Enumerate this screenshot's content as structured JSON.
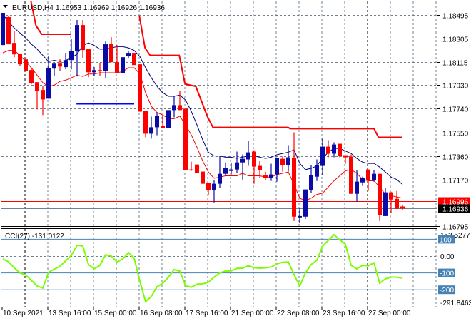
{
  "header": {
    "menu_icon": "triangle-down-icon",
    "symbol": "EURUSD,H4",
    "ohlc": "1.16953 1.16969 1.16926 1.16936"
  },
  "colors": {
    "bull": "#0a0aa8",
    "bear": "#ff0000",
    "ma_fast": "#ff0000",
    "ma_slow": "#000080",
    "stop_line": "#ff0000",
    "level_line": "#0000ff",
    "cci": "#7cfc00",
    "cci_levels": "#4682b4",
    "grid": "#708090",
    "bid_tag": "#ff0000",
    "ask_tag": "#000000"
  },
  "chart_data": [
    {
      "type": "candlestick",
      "title": "EURUSD,H4",
      "ylim": [
        1.16795,
        1.18495
      ],
      "price_ticks": [
        "1.18495",
        "1.18305",
        "1.18115",
        "1.17930",
        "1.17740",
        "1.17550",
        "1.17360",
        "1.17170",
        "1.16795"
      ],
      "price_tags": [
        {
          "label": "1.16996",
          "value": 1.16996,
          "kind": "bid"
        },
        {
          "label": "1.16936",
          "value": 1.16936,
          "kind": "ask"
        }
      ],
      "time_labels": [
        {
          "label": "10 Sep 2021",
          "index": 0
        },
        {
          "label": "13 Sep 16:00",
          "index": 8
        },
        {
          "label": "15 Sep 00:00",
          "index": 16
        },
        {
          "label": "16 Sep 08:00",
          "index": 24
        },
        {
          "label": "17 Sep 16:00",
          "index": 32
        },
        {
          "label": "21 Sep 00:00",
          "index": 40
        },
        {
          "label": "22 Sep 08:00",
          "index": 48
        },
        {
          "label": "23 Sep 16:00",
          "index": 56
        },
        {
          "label": "27 Sep 00:00",
          "index": 64
        }
      ],
      "candles": [
        [
          1.18253,
          1.18512,
          1.18253,
          1.18512
        ],
        [
          1.18478,
          1.18484,
          1.18259,
          1.18259
        ],
        [
          1.1827,
          1.18368,
          1.18155,
          1.18178
        ],
        [
          1.18184,
          1.18184,
          1.18086,
          1.18098
        ],
        [
          1.18138,
          1.18138,
          1.18046,
          1.18046
        ],
        [
          1.18052,
          1.18069,
          1.17937,
          1.17948
        ],
        [
          1.17954,
          1.17954,
          1.17735,
          1.17885
        ],
        [
          1.17891,
          1.17925,
          1.17689,
          1.17815
        ],
        [
          1.17821,
          1.18167,
          1.17821,
          1.18069
        ],
        [
          1.18063,
          1.18109,
          1.18005,
          1.18103
        ],
        [
          1.18103,
          1.18138,
          1.18046,
          1.1808
        ],
        [
          1.18075,
          1.1819,
          1.18057,
          1.18132
        ],
        [
          1.18132,
          1.18299,
          1.18057,
          1.18207
        ],
        [
          1.18207,
          1.18455,
          1.18,
          1.18414
        ],
        [
          1.18414,
          1.18455,
          1.18149,
          1.18213
        ],
        [
          1.18219,
          1.18219,
          1.17994,
          1.18034
        ],
        [
          1.18034,
          1.18075,
          1.18005,
          1.18051
        ],
        [
          1.18051,
          1.18109,
          1.18005,
          1.18046
        ],
        [
          1.18046,
          1.18282,
          1.17988,
          1.18259
        ],
        [
          1.18265,
          1.18316,
          1.18115,
          1.18115
        ],
        [
          1.18115,
          1.18253,
          1.18028,
          1.18028
        ],
        [
          1.18028,
          1.18155,
          1.18028,
          1.18155
        ],
        [
          1.18167,
          1.18207,
          1.18144,
          1.1819
        ],
        [
          1.1819,
          1.1819,
          1.18092,
          1.18092
        ],
        [
          1.18098,
          1.18098,
          1.17717,
          1.17717
        ],
        [
          1.17723,
          1.17723,
          1.1751,
          1.17539
        ],
        [
          1.17539,
          1.17677,
          1.17499,
          1.17591
        ],
        [
          1.17591,
          1.17712,
          1.17527,
          1.17683
        ],
        [
          1.17602,
          1.17689,
          1.17585,
          1.17585
        ],
        [
          1.17585,
          1.17729,
          1.17585,
          1.17729
        ],
        [
          1.17729,
          1.17844,
          1.17671,
          1.17769
        ],
        [
          1.17769,
          1.17884,
          1.17729,
          1.17729
        ],
        [
          1.1774,
          1.1774,
          1.17245,
          1.17245
        ],
        [
          1.17251,
          1.17314,
          1.17239,
          1.17245
        ],
        [
          1.17291,
          1.17291,
          1.17222,
          1.17222
        ],
        [
          1.17234,
          1.17234,
          1.17136,
          1.17136
        ],
        [
          1.17141,
          1.17141,
          1.17044,
          1.17084
        ],
        [
          1.17084,
          1.17164,
          1.16986,
          1.17136
        ],
        [
          1.17136,
          1.1736,
          1.17101,
          1.17216
        ],
        [
          1.17216,
          1.17308,
          1.17199,
          1.17262
        ],
        [
          1.17239,
          1.17303,
          1.17211,
          1.17251
        ],
        [
          1.17251,
          1.17395,
          1.17222,
          1.17308
        ],
        [
          1.17308,
          1.17372,
          1.1717,
          1.17337
        ],
        [
          1.17332,
          1.17481,
          1.1728,
          1.17389
        ],
        [
          1.17395,
          1.17406,
          1.17136,
          1.17274
        ],
        [
          1.1728,
          1.1732,
          1.17182,
          1.17245
        ],
        [
          1.17205,
          1.17234,
          1.17164,
          1.17182
        ],
        [
          1.17182,
          1.17297,
          1.17159,
          1.17211
        ],
        [
          1.17211,
          1.17343,
          1.17153,
          1.17343
        ],
        [
          1.17337,
          1.1736,
          1.17234,
          1.17285
        ],
        [
          1.17285,
          1.17447,
          1.17234,
          1.17349
        ],
        [
          1.17343,
          1.1755,
          1.16836,
          1.16871
        ],
        [
          1.16865,
          1.1694,
          1.16819,
          1.16876
        ],
        [
          1.16871,
          1.1709,
          1.16853,
          1.1709
        ],
        [
          1.17084,
          1.17285,
          1.17061,
          1.17205
        ],
        [
          1.17193,
          1.17332,
          1.17159,
          1.17285
        ],
        [
          1.1728,
          1.17499,
          1.17205,
          1.17435
        ],
        [
          1.17435,
          1.17487,
          1.17349,
          1.17378
        ],
        [
          1.17378,
          1.1747,
          1.17349,
          1.17452
        ],
        [
          1.17458,
          1.17458,
          1.17349,
          1.1736
        ],
        [
          1.17366,
          1.17366,
          1.17297,
          1.17349
        ],
        [
          1.17355,
          1.17372,
          1.17055,
          1.17055
        ],
        [
          1.17055,
          1.17245,
          1.16992,
          1.17153
        ],
        [
          1.17147,
          1.17193,
          1.17118,
          1.17182
        ],
        [
          1.17251,
          1.17251,
          1.17078,
          1.17164
        ],
        [
          1.17164,
          1.17245,
          1.17153,
          1.17216
        ],
        [
          1.17216,
          1.17216,
          1.16836,
          1.16882
        ],
        [
          1.16876,
          1.17101,
          1.16876,
          1.17067
        ],
        [
          1.17067,
          1.17072,
          1.169,
          1.17009
        ],
        [
          1.17015,
          1.17078,
          1.16934,
          1.16934
        ],
        [
          1.16953,
          1.16969,
          1.16926,
          1.16936
        ]
      ],
      "ma_slow": [
        1.185,
        1.1844,
        1.1839,
        1.1835,
        1.1831,
        1.1826,
        1.1822,
        1.1817,
        1.1812,
        1.1813,
        1.1812,
        1.1813,
        1.1815,
        1.1818,
        1.1825,
        1.1827,
        1.1825,
        1.1822,
        1.1822,
        1.1823,
        1.1824,
        1.1824,
        1.1823,
        1.1821,
        1.1816,
        1.1807,
        1.1799,
        1.1792,
        1.1787,
        1.1784,
        1.1784,
        1.1785,
        1.1781,
        1.1772,
        1.1761,
        1.1749,
        1.1739,
        1.1736,
        1.1736,
        1.1735,
        1.1735,
        1.1734,
        1.1735,
        1.1736,
        1.1736,
        1.1735,
        1.1734,
        1.1735,
        1.1737,
        1.1738,
        1.1739,
        1.1741,
        1.173,
        1.1725,
        1.1726,
        1.1728,
        1.1734,
        1.1739,
        1.1742,
        1.1742,
        1.174,
        1.1738,
        1.1734,
        1.1731,
        1.173,
        1.173,
        1.1727,
        1.1723,
        1.1719,
        1.1717,
        1.1713
      ],
      "ma_fast": [
        1.1819,
        1.1821,
        1.1821,
        1.1817,
        1.1812,
        1.1807,
        1.1801,
        1.1795,
        1.1792,
        1.1793,
        1.1796,
        1.1797,
        1.1799,
        1.1801,
        1.18,
        1.1802,
        1.1802,
        1.1803,
        1.1803,
        1.1803,
        1.1803,
        1.1804,
        1.1807,
        1.1807,
        1.1802,
        1.1787,
        1.1776,
        1.1771,
        1.1769,
        1.1766,
        1.1766,
        1.1768,
        1.1761,
        1.1753,
        1.1743,
        1.1732,
        1.1723,
        1.1718,
        1.1719,
        1.172,
        1.172,
        1.172,
        1.1722,
        1.172,
        1.172,
        1.172,
        1.1719,
        1.1719,
        1.1721,
        1.1722,
        1.1723,
        1.1713,
        1.1702,
        1.17,
        1.1702,
        1.1705,
        1.1706,
        1.1711,
        1.1716,
        1.172,
        1.1724,
        1.1725,
        1.1722,
        1.1717,
        1.1716,
        1.1716,
        1.1711,
        1.1705,
        1.1704,
        1.1703,
        1.1702
      ],
      "stop_line": [
        [
          [
            4.9,
            1.1861
          ],
          [
            5.8,
            1.1841
          ],
          [
            6.8,
            1.1834
          ],
          [
            11.9,
            1.1834
          ]
        ],
        [
          [
            23.9,
            1.1849
          ],
          [
            24.9,
            1.1823
          ],
          [
            25.8,
            1.1817
          ],
          [
            30.9,
            1.1817
          ],
          [
            31.9,
            1.1794
          ],
          [
            33.8,
            1.1792
          ],
          [
            35.8,
            1.1768
          ],
          [
            36.8,
            1.1759
          ],
          [
            50,
            1.1759
          ],
          [
            50.3,
            1.1758
          ],
          [
            65,
            1.1758
          ],
          [
            65.8,
            1.1751
          ],
          [
            70,
            1.1751
          ]
        ]
      ],
      "level_segment": {
        "from_index": 12.9,
        "to_index": 23,
        "value": 1.1778
      }
    },
    {
      "type": "line",
      "title": "CCI(27)",
      "label": "CCI(27) -131.0122",
      "ylim": [
        -291.8463,
        153.5277
      ],
      "axis_labels": [
        {
          "label": "153.5277",
          "value": 153.5277,
          "boxed": false
        },
        {
          "label": "100",
          "value": 100,
          "boxed": true
        },
        {
          "label": "0.00",
          "value": 0,
          "boxed": false
        },
        {
          "label": "-100",
          "value": -100,
          "boxed": true
        },
        {
          "label": "-200",
          "value": -200,
          "boxed": true
        },
        {
          "label": "-291.8463",
          "value": -291.8463,
          "boxed": false
        }
      ],
      "levels": [
        100,
        -100,
        -200
      ],
      "values": [
        -17,
        -34,
        -70,
        -100,
        -112,
        -145,
        -178,
        -190,
        -97,
        -78,
        -61,
        -28,
        4,
        64,
        60,
        -50,
        -76,
        -55,
        8,
        0,
        -36,
        -17,
        21,
        -13,
        -150,
        -271,
        -240,
        -182,
        -162,
        -126,
        -80,
        -90,
        -176,
        -185,
        -167,
        -165,
        -155,
        -125,
        -100,
        -89,
        -88,
        -73,
        -72,
        -57,
        -69,
        -72,
        -70,
        -65,
        -46,
        -37,
        -35,
        -110,
        -178,
        -100,
        -50,
        -25,
        58,
        93,
        127,
        97,
        70,
        -55,
        -76,
        -55,
        -58,
        -40,
        -161,
        -135,
        -125,
        -125,
        -131.0122
      ]
    }
  ]
}
